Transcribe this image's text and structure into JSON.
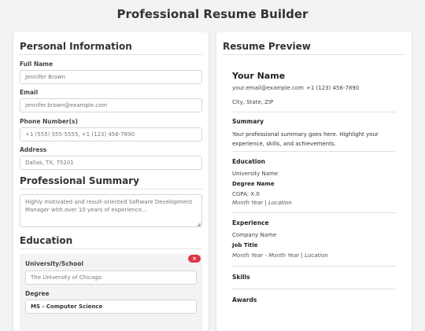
{
  "app": {
    "title": "Professional Resume Builder"
  },
  "form": {
    "personal": {
      "heading": "Personal Information",
      "full_name_label": "Full Name",
      "full_name_placeholder": "Jennifer Brown",
      "email_label": "Email",
      "email_placeholder": "jennifer.brown@example.com",
      "phone_label": "Phone Number(s)",
      "phone_placeholder": "+1 (555) 555-5555, +1 (123) 456-7890",
      "address_label": "Address",
      "address_placeholder": "Dallas, TX, 75201"
    },
    "summary": {
      "heading": "Professional Summary",
      "placeholder": "Highly motivated and result-oriented Software Development Manager with over 10 years of experience..."
    },
    "education": {
      "heading": "Education",
      "remove_label": "×",
      "entries": [
        {
          "school_label": "University/School",
          "school_placeholder": "The University of Chicago",
          "degree_label": "Degree",
          "degree_value": "MS - Computer Science"
        }
      ]
    }
  },
  "preview": {
    "heading": "Resume Preview",
    "name": "Your Name",
    "email": "your.email@example.com",
    "phone": "+1 (123) 456-7890",
    "location": "City, State, ZIP",
    "summary_heading": "Summary",
    "summary_text": "Your professional summary goes here. Highlight your experience, skills, and achievements.",
    "education_heading": "Education",
    "edu_school": "University Name",
    "edu_degree": "Degree Name",
    "edu_cgpa": "CGPA: X.0",
    "edu_meta": "Month Year | Location",
    "experience_heading": "Experience",
    "exp_company": "Company Name",
    "exp_title": "Job Title",
    "exp_meta": "Month Year - Month Year | Location",
    "skills_heading": "Skills",
    "awards_heading": "Awards"
  }
}
